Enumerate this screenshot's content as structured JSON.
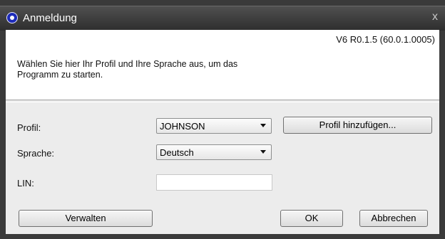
{
  "window": {
    "title": "Anmeldung",
    "close_glyph": "x"
  },
  "header": {
    "version": "V6 R0.1.5 (60.0.1.0005)",
    "intro_text": "Wählen Sie hier Ihr Profil und Ihre Sprache aus, um das Programm zu starten."
  },
  "form": {
    "profile_label": "Profil:",
    "profile_value": "JOHNSON",
    "add_profile_label": "Profil hinzufügen...",
    "language_label": "Sprache:",
    "language_value": "Deutsch",
    "lin_label": "LIN:",
    "lin_value": ""
  },
  "footer": {
    "manage_label": "Verwalten",
    "ok_label": "OK",
    "cancel_label": "Abbrechen"
  },
  "icons": {
    "app": "app-logo-icon",
    "dropdown": "chevron-down-icon"
  }
}
